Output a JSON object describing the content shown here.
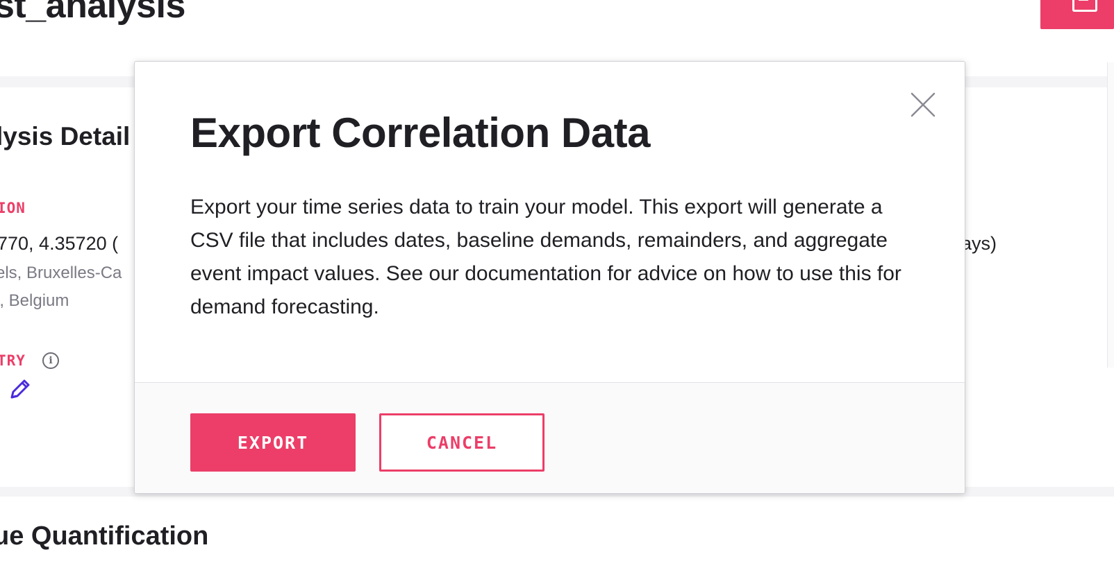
{
  "page": {
    "title": "st_analysis",
    "details_title": "lysis Detail",
    "location_label": "ION",
    "coordinates": "770, 4.35720 (",
    "address_line1": "els, Bruxelles-Ca",
    "address_line2": "l, Belgium",
    "industry_label": "TRY",
    "info_icon": "i",
    "days_fragment": "lays)",
    "impact_section_title": "ue Quantification"
  },
  "modal": {
    "title": "Export Correlation Data",
    "body": "Export your time series data to train your model. This export will generate a CSV file that includes dates, baseline demands, remainders, and aggregate event impact values. See our documentation for advice on how to use this for demand forecasting.",
    "export_label": "EXPORT",
    "cancel_label": "CANCEL"
  },
  "icons": {
    "close": "close-icon",
    "info": "info-icon",
    "edit": "pencil-icon",
    "download": "download-icon"
  },
  "colors": {
    "accent": "#ec3e68",
    "text": "#1f1f24",
    "muted": "#7a7a84",
    "edit_icon": "#4b2bdc"
  }
}
